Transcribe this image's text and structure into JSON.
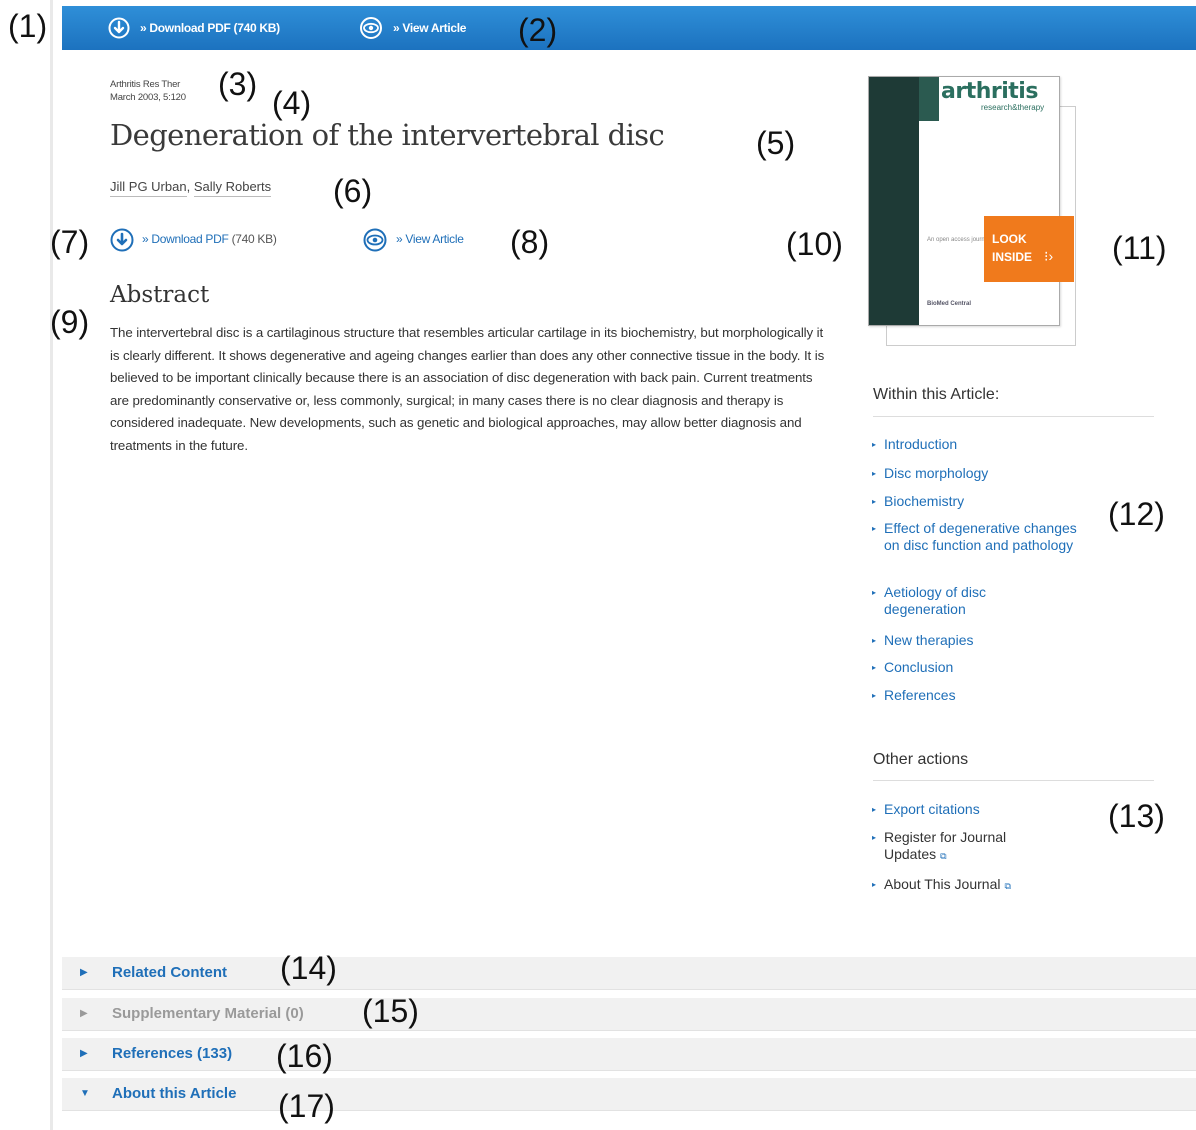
{
  "callouts": [
    "(1)",
    "(2)",
    "(3)",
    "(4)",
    "(5)",
    "(6)",
    "(7)",
    "(8)",
    "(9)",
    "(10)",
    "(11)",
    "(12)",
    "(13)",
    "(14)",
    "(15)",
    "(16)",
    "(17)"
  ],
  "topbar": {
    "download_label": "» Download PDF (740 KB)",
    "view_label": "» View Article",
    "download_icon": "download-circle-icon",
    "view_icon": "eye-icon",
    "bg_color": "#1c72bf"
  },
  "article": {
    "journal": "Arthritis Res Ther",
    "date": "March 2003, 5:120",
    "title": "Degeneration of the intervertebral disc",
    "authors": [
      "Jill PG Urban",
      "Sally Roberts"
    ],
    "download_label": "» Download PDF",
    "download_size": "(740 KB)",
    "view_label": "» View Article",
    "abstract_heading": "Abstract",
    "abstract": "The intervertebral disc is a cartilaginous structure that resembles articular cartilage in its biochemistry, but morphologically it is clearly different. It shows degenerative and ageing changes earlier than does any other connective tissue in the body. It is believed to be important clinically because there is an association of disc degeneration with back pain. Current treatments are predominantly conservative or, less commonly, surgical; in many cases there is no clear diagnosis and therapy is considered inadequate. New developments, such as genetic and biological approaches, may allow better diagnosis and treatments in the future."
  },
  "cover": {
    "journal_name": "arthritis",
    "journal_sub": "research&therapy",
    "open_access": "An open access journal",
    "publisher": "BioMed Central",
    "look_inside_1": "LOOK",
    "look_inside_2": "INSIDE",
    "accent_color": "#f07a1c"
  },
  "within": {
    "heading": "Within this Article:",
    "items": [
      "Introduction",
      "Disc morphology",
      "Biochemistry",
      "Effect of degenerative changes on disc function and pathology",
      "Aetiology of disc degeneration",
      "New therapies",
      "Conclusion",
      "References"
    ]
  },
  "other": {
    "heading": "Other actions",
    "items": [
      "Export citations",
      "Register for Journal Updates",
      "About This Journal"
    ]
  },
  "accordions": [
    {
      "label": "Related Content",
      "state": "collapsed"
    },
    {
      "label": "Supplementary Material (0)",
      "state": "disabled"
    },
    {
      "label": "References (133)",
      "state": "collapsed"
    },
    {
      "label": "About this Article",
      "state": "expanded"
    }
  ]
}
